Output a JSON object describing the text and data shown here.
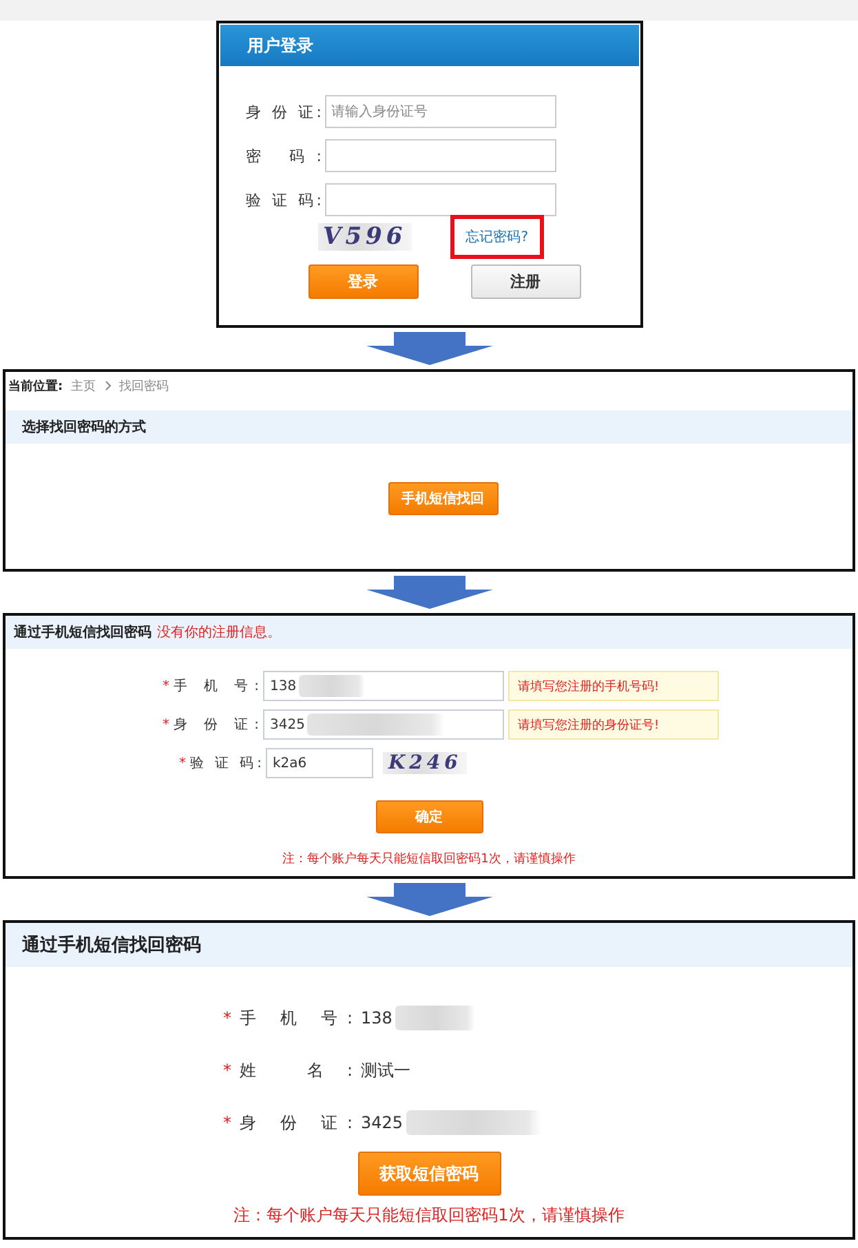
{
  "login_panel": {
    "title": "用户登录",
    "fields": [
      {
        "label": "身 份 证:",
        "placeholder": "请输入身份证号"
      },
      {
        "label": "密 码:"
      },
      {
        "label": "验 证 码:"
      }
    ],
    "captcha": "V596",
    "forgot_link": {
      "text": "忘记密码?",
      "highlighted": true
    },
    "buttons": [
      {
        "label": "登录",
        "kind": "primary"
      },
      {
        "label": "注册",
        "kind": "secondary"
      }
    ]
  },
  "choose_panel": {
    "breadcrumb": {
      "label": "当前位置:",
      "items": [
        "主页",
        "找回密码"
      ]
    },
    "title": "选择找回密码的方式",
    "button": "手机短信找回"
  },
  "sms_form": {
    "title": "通过手机短信找回密码",
    "error": "没有你的注册信息。",
    "fields": [
      {
        "marker": "*",
        "label": "手 机 号:",
        "value": "138",
        "redacted": true,
        "hint": "请填写您注册的手机号码!"
      },
      {
        "marker": "*",
        "label": "身 份 证:",
        "value": "3425",
        "redacted": true,
        "hint": "请填写您注册的身份证号!"
      },
      {
        "marker": "*",
        "label": "验 证 码:",
        "value": "k2a6",
        "redacted": false,
        "captcha": "K246"
      }
    ],
    "button": "确定",
    "note": "注：每个账户每天只能短信取回密码1次，请谨慎操作"
  },
  "sms_confirm": {
    "title": "通过手机短信找回密码",
    "rows": [
      {
        "marker": "*",
        "label": "手 机 号:",
        "value": "138",
        "redacted": true
      },
      {
        "marker": "*",
        "label": "姓 名:",
        "value": "测试一",
        "redacted": false
      },
      {
        "marker": "*",
        "label": "身 份 证:",
        "value": "3425",
        "redacted": true
      }
    ],
    "button": "获取短信密码",
    "note": "注：每个账户每天只能短信取回密码1次，请谨慎操作"
  }
}
